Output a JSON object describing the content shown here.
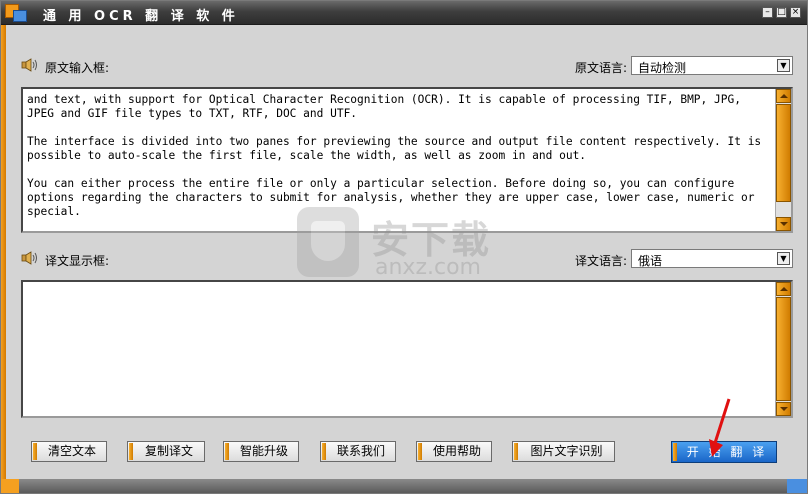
{
  "window": {
    "title": "通 用 OCR 翻 译 软 件",
    "controls": [
      "–",
      "□",
      "×"
    ]
  },
  "source": {
    "label": "原文输入框:",
    "lang_label": "原文语言:",
    "lang_value": "自动检测",
    "text": "and text, with support for Optical Character Recognition (OCR). It is capable of processing TIF, BMP, JPG, JPEG and GIF file types to TXT, RTF, DOC and UTF.\n\nThe interface is divided into two panes for previewing the source and output file content respectively. It is possible to auto-scale the first file, scale the width, as well as zoom in and out.\n\nYou can either process the entire file or only a particular selection. Before doing so, you can configure options regarding the characters to submit for analysis, whether they are upper case, lower case, numeric or special."
  },
  "target": {
    "label": "译文显示框:",
    "lang_label": "译文语言:",
    "lang_value": "俄语",
    "text": ""
  },
  "buttons": {
    "clear": "清空文本",
    "copy": "复制译文",
    "upgrade": "智能升级",
    "contact": "联系我们",
    "help": "使用帮助",
    "ocr": "图片文字识别",
    "translate": "开 始 翻 译"
  },
  "watermark": {
    "main": "安下载",
    "sub": "anxz.com"
  },
  "icons": {
    "speaker": "speaker-icon",
    "dropdown": "dropdown-arrow-icon",
    "app": "app-logo-icon"
  }
}
